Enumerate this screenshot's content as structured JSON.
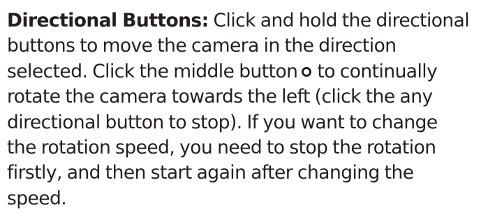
{
  "heading": "Directional Buttons:",
  "lines": [
    " Click and hold the directional",
    "buttons to move the camera in the direction",
    "selected. Click the middle button",
    "to continually",
    "rotate the camera towards the left (click the any",
    "directional button to stop). If you want to change",
    "the rotation speed, you need to stop the rotation",
    "firstly, and then start again after changing the",
    "speed."
  ],
  "icon": "circle-icon"
}
